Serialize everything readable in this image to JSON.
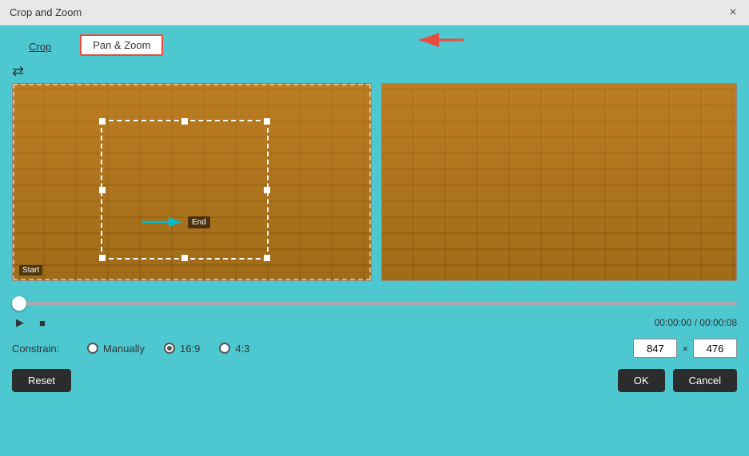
{
  "window": {
    "title": "Crop and Zoom",
    "close_label": "×"
  },
  "tabs": {
    "crop_label": "Crop",
    "pan_zoom_label": "Pan & Zoom",
    "active": "pan_zoom"
  },
  "controls": {
    "repeat_icon": "↺"
  },
  "video": {
    "start_label": "Start",
    "end_label": "End"
  },
  "playback": {
    "play_icon": "▶",
    "stop_icon": "■",
    "time_display": "00:00:00 / 00:00:08"
  },
  "constrain": {
    "label": "Constrain:",
    "manually_label": "Manually",
    "ratio_16_9_label": "16:9",
    "ratio_4_3_label": "4:3",
    "width_value": "847",
    "height_value": "476",
    "size_separator": "×"
  },
  "actions": {
    "reset_label": "Reset",
    "ok_label": "OK",
    "cancel_label": "Cancel"
  }
}
